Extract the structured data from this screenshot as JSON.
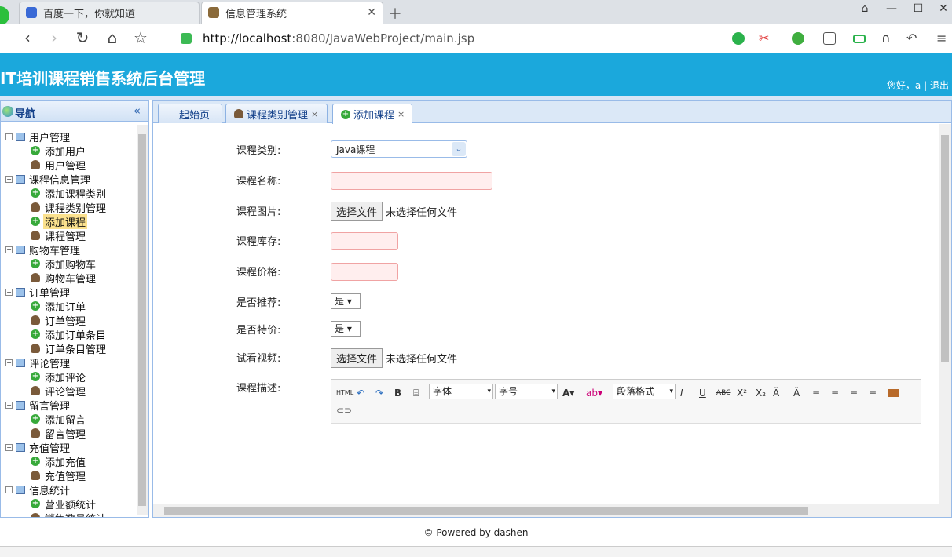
{
  "browser": {
    "tabs": [
      {
        "label": "百度一下，你就知道"
      },
      {
        "label": "信息管理系统"
      }
    ],
    "url_host": "http://localhost",
    "url_rest": ":8080/JavaWebProject/main.jsp"
  },
  "app": {
    "title": "IT培训课程销售系统后台管理",
    "greeting": "您好，a",
    "separator": "|",
    "logout": "退出"
  },
  "sidebar": {
    "title": "导航",
    "tree": [
      {
        "label": "用户管理",
        "type": "group"
      },
      {
        "label": "添加用户",
        "type": "add"
      },
      {
        "label": "用户管理",
        "type": "person"
      },
      {
        "label": "课程信息管理",
        "type": "group"
      },
      {
        "label": "添加课程类别",
        "type": "add"
      },
      {
        "label": "课程类别管理",
        "type": "person"
      },
      {
        "label": "添加课程",
        "type": "add",
        "selected": true
      },
      {
        "label": "课程管理",
        "type": "person"
      },
      {
        "label": "购物车管理",
        "type": "group"
      },
      {
        "label": "添加购物车",
        "type": "add"
      },
      {
        "label": "购物车管理",
        "type": "person"
      },
      {
        "label": "订单管理",
        "type": "group"
      },
      {
        "label": "添加订单",
        "type": "add"
      },
      {
        "label": "订单管理",
        "type": "person"
      },
      {
        "label": "添加订单条目",
        "type": "add"
      },
      {
        "label": "订单条目管理",
        "type": "person"
      },
      {
        "label": "评论管理",
        "type": "group"
      },
      {
        "label": "添加评论",
        "type": "add"
      },
      {
        "label": "评论管理",
        "type": "person"
      },
      {
        "label": "留言管理",
        "type": "group"
      },
      {
        "label": "添加留言",
        "type": "add"
      },
      {
        "label": "留言管理",
        "type": "person"
      },
      {
        "label": "充值管理",
        "type": "group"
      },
      {
        "label": "添加充值",
        "type": "add"
      },
      {
        "label": "充值管理",
        "type": "person"
      },
      {
        "label": "信息统计",
        "type": "group"
      },
      {
        "label": "营业额统计",
        "type": "add"
      },
      {
        "label": "销售数量统计",
        "type": "person"
      }
    ]
  },
  "content_tabs": [
    {
      "label": "起始页"
    },
    {
      "label": "课程类别管理",
      "close": "×"
    },
    {
      "label": "添加课程",
      "close": "×"
    }
  ],
  "form": {
    "category_label": "课程类别:",
    "category_value": "Java课程",
    "name_label": "课程名称:",
    "image_label": "课程图片:",
    "file_button": "选择文件",
    "no_file": "未选择任何文件",
    "stock_label": "课程库存:",
    "price_label": "课程价格:",
    "recommend_label": "是否推荐:",
    "recommend_value": "是",
    "special_label": "是否特价:",
    "special_value": "是",
    "video_label": "试看视频:",
    "desc_label": "课程描述:"
  },
  "editor": {
    "html": "HTML",
    "font": "字体",
    "size": "字号",
    "paragraph": "段落格式"
  },
  "footer": "© Powered by dashen"
}
